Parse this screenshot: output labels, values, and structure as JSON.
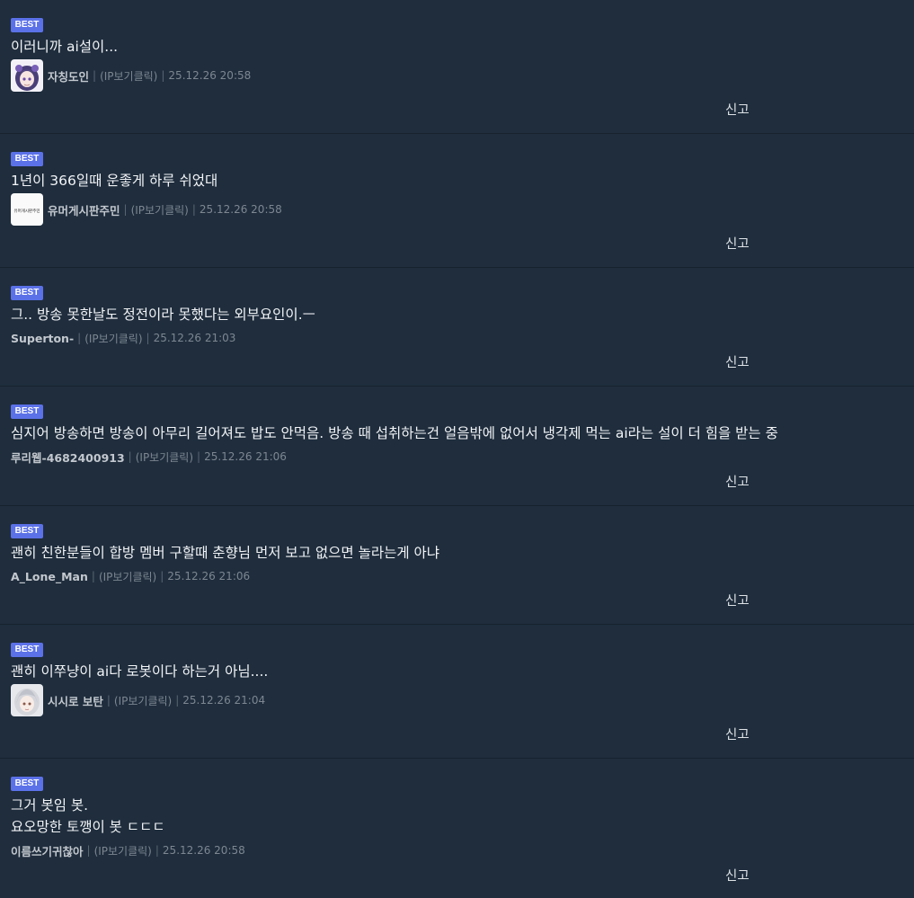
{
  "best_label": "BEST",
  "report_label": "신고",
  "ip_label": "(IP보기클릭)",
  "separator": "|",
  "colors": {
    "background": "#1f2d3d",
    "badge": "#5b71e8",
    "divider": "#17222e"
  },
  "comments": [
    {
      "text": "이러니까 ai설이...",
      "author": "자칭도인",
      "date": "25.12.26 20:58",
      "avatar": "anime-girl-avatar"
    },
    {
      "text": "1년이 366일때 운좋게 하루 쉬었대",
      "author": "유머게시판주민",
      "date": "25.12.26 20:58",
      "avatar": "handwritten-text-avatar",
      "avatar_text": "유머게시판주민"
    },
    {
      "text": "그.. 방송 못한날도 정전이라 못했다는 외부요인이.ㅡ",
      "author": "Superton-",
      "date": "25.12.26 21:03"
    },
    {
      "text": "심지어 방송하면 방송이 아무리 길어져도 밥도 안먹음. 방송 때 섭취하는건 얼음밖에 없어서 냉각제 먹는 ai라는 설이 더 힘을 받는 중",
      "author": "루리웹-4682400913",
      "date": "25.12.26 21:06"
    },
    {
      "text": "괜히 친한분들이 합방 멤버 구할때 춘향님 먼저 보고 없으면 놀라는게 아냐",
      "author": "A_Lone_Man",
      "date": "25.12.26 21:06"
    },
    {
      "text": "괜히 이쭈냥이 ai다 로봇이다 하는거 아님....",
      "author": "시시로 보탄",
      "date": "25.12.26 21:04",
      "avatar": "white-hair-character-avatar"
    },
    {
      "text": "그거 봇임 봇.\n요오망한 토깽이 봇 ㄷㄷㄷ",
      "author": "이름쓰기귀찮아",
      "date": "25.12.26 20:58"
    }
  ]
}
